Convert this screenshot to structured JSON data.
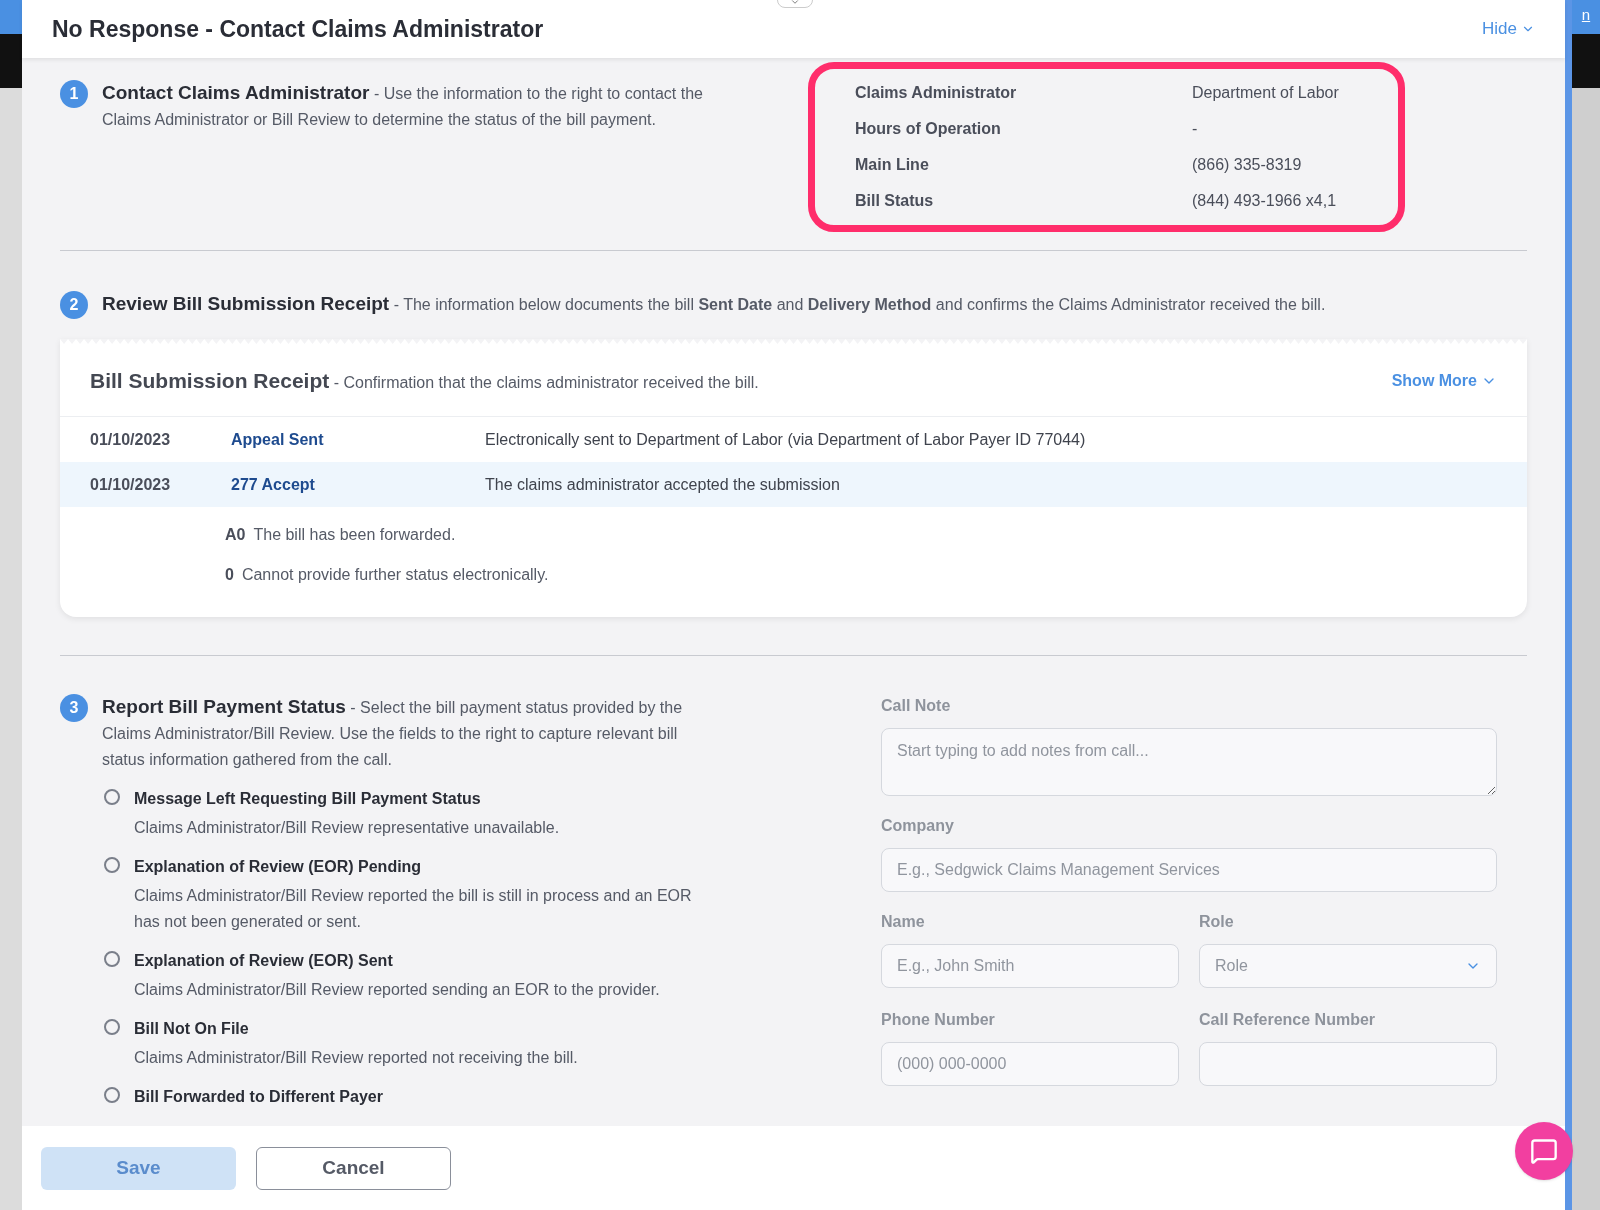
{
  "header": {
    "title": "No Response - Contact Claims Administrator",
    "hide_label": "Hide"
  },
  "corner_link": "n",
  "step1": {
    "number": "1",
    "title": "Contact Claims Administrator",
    "text": "- Use the information to the right to contact the Claims Administrator or Bill Review to determine the status of the bill payment."
  },
  "contact_info": [
    {
      "label": "Claims Administrator",
      "value": "Department of Labor"
    },
    {
      "label": "Hours of Operation",
      "value": "-"
    },
    {
      "label": "Main Line",
      "value": "(866) 335-8319"
    },
    {
      "label": "Bill Status",
      "value": "(844) 493-1966 x4,1"
    }
  ],
  "step2": {
    "number": "2",
    "title": "Review Bill Submission Receipt",
    "text": "- The information below documents the bill **Sent Date** and **Delivery Method** and confirms the Claims Administrator received the bill."
  },
  "receipt": {
    "title": "Bill Submission Receipt",
    "subtitle": "- Confirmation that the claims administrator received the bill.",
    "show_more": "Show More",
    "rows": [
      {
        "date": "01/10/2023",
        "event": "Appeal Sent",
        "description": "Electronically sent to Department of Labor (via Department of Labor Payer ID 77044)",
        "selected": false
      },
      {
        "date": "01/10/2023",
        "event": "277 Accept",
        "description": "The claims administrator accepted the submission",
        "selected": true
      }
    ],
    "codes": [
      {
        "code": "A0",
        "text": "The bill has been forwarded."
      },
      {
        "code": "0",
        "text": "Cannot provide further status electronically."
      }
    ]
  },
  "step3": {
    "number": "3",
    "title": "Report Bill Payment Status",
    "text": "- Select the bill payment status provided by the Claims Administrator/Bill Review. Use the fields to the right to capture relevant bill status information gathered from the call."
  },
  "statuses": [
    {
      "label": "Message Left Requesting Bill Payment Status",
      "description": "Claims Administrator/Bill Review representative unavailable.",
      "selected": false
    },
    {
      "label": "Explanation of Review (EOR) Pending",
      "description": "Claims Administrator/Bill Review reported the bill is still in process and an EOR has not been generated or sent.",
      "selected": false
    },
    {
      "label": "Explanation of Review (EOR) Sent",
      "description": "Claims Administrator/Bill Review reported sending an EOR to the provider.",
      "selected": false
    },
    {
      "label": "Bill Not On File",
      "description": "Claims Administrator/Bill Review reported not receiving the bill.",
      "selected": false
    },
    {
      "label": "Bill Forwarded to Different Payer",
      "selected": false
    }
  ],
  "form": {
    "disabled": true,
    "call_note": {
      "label": "Call Note",
      "placeholder": "Start typing to add notes from call..."
    },
    "company": {
      "label": "Company",
      "placeholder": "E.g., Sedgwick Claims Management Services"
    },
    "name": {
      "label": "Name",
      "placeholder": "E.g., John Smith"
    },
    "role": {
      "label": "Role",
      "placeholder": "Role"
    },
    "phone": {
      "label": "Phone Number",
      "placeholder": "(000) 000-0000"
    },
    "call_reference": {
      "label": "Call Reference Number"
    }
  },
  "buttons": {
    "save": {
      "label": "Save",
      "disabled": true
    },
    "cancel": {
      "label": "Cancel"
    }
  }
}
